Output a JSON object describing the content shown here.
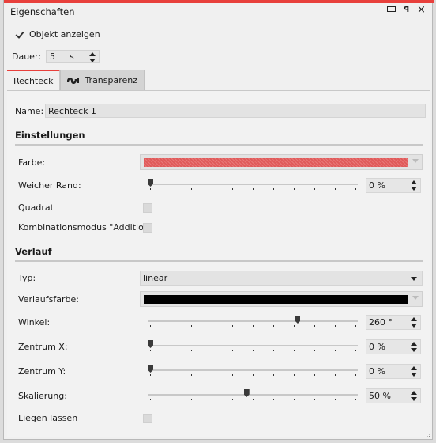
{
  "window": {
    "title": "Eigenschaften",
    "accent_color": "#e8403c",
    "buttons": [
      {
        "icon": "restore-icon"
      },
      {
        "icon": "pin-icon",
        "glyph": "ᵽ"
      },
      {
        "icon": "close-icon",
        "glyph": "×"
      }
    ]
  },
  "general": {
    "show_object_label": "Objekt anzeigen",
    "show_object_checked": true,
    "duration_label": "Dauer:",
    "duration_value": "5",
    "duration_unit": "s"
  },
  "tabs": [
    {
      "label": "Rechteck",
      "active": true
    },
    {
      "label": "Transparenz",
      "active": false,
      "icon": "transparency-icon"
    }
  ],
  "name_field": {
    "label": "Name:",
    "value": "Rechteck 1"
  },
  "settings": {
    "header": "Einstellungen",
    "farbe_label": "Farbe:",
    "farbe_color": "#e05a5a",
    "weicher_rand_label": "Weicher Rand:",
    "weicher_rand_value": "0 %",
    "weicher_rand_level": 0,
    "quadrat_label": "Quadrat",
    "quadrat_checked": false,
    "kombi_label": "Kombinationsmodus \"Addition\"",
    "kombi_checked": false
  },
  "gradient": {
    "header": "Verlauf",
    "typ_label": "Typ:",
    "typ_value": "linear",
    "verlaufsfarbe_label": "Verlaufsfarbe:",
    "verlaufsfarbe_color": "#000000",
    "winkel_label": "Winkel:",
    "winkel_value": "260 °",
    "winkel_level": 0.72,
    "zentrum_x_label": "Zentrum X:",
    "zentrum_x_value": "0 %",
    "zentrum_x_level": 0,
    "zentrum_y_label": "Zentrum Y:",
    "zentrum_y_value": "0 %",
    "zentrum_y_level": 0,
    "skalierung_label": "Skalierung:",
    "skalierung_value": "50 %",
    "skalierung_level": 0.47,
    "liegen_label": "Liegen lassen",
    "liegen_checked": false
  }
}
